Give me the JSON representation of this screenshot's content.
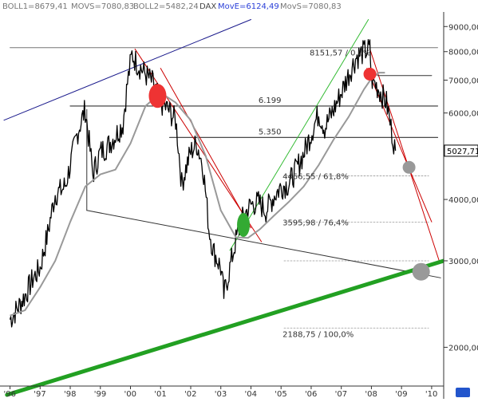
{
  "header": {
    "boll1": "BOLL1=8679,41",
    "movs": "MOVS=7080,83",
    "boll2": "BOLL2=5482,24",
    "symbol": "DAX",
    "move": "MovE=6124,49",
    "movs2": "MovS=7080,83"
  },
  "colors": {
    "price_bars": "#000000",
    "moving_avg": "#999999",
    "channel_red": "#cc0000",
    "trend_green_thick": "#22a022",
    "trend_green_thin": "#33bb33",
    "trend_blue": "#1a1a8c",
    "marker_red": "#ee3333",
    "marker_green": "#33aa33",
    "marker_gray": "#999999",
    "header_move": "#2a3fd8"
  },
  "chart_data": {
    "type": "line",
    "y_scale": "log",
    "ylim": [
      1680,
      9600
    ],
    "xlim": [
      1995.8,
      2010.4
    ],
    "x_ticks": [
      {
        "label": "'96",
        "x": 1996
      },
      {
        "label": "'97",
        "x": 1997
      },
      {
        "label": "'98",
        "x": 1998
      },
      {
        "label": "'99",
        "x": 1999
      },
      {
        "label": "'00",
        "x": 2000
      },
      {
        "label": "'01",
        "x": 2001
      },
      {
        "label": "'02",
        "x": 2002
      },
      {
        "label": "'03",
        "x": 2003
      },
      {
        "label": "'04",
        "x": 2004
      },
      {
        "label": "'05",
        "x": 2005
      },
      {
        "label": "'06",
        "x": 2006
      },
      {
        "label": "'07",
        "x": 2007
      },
      {
        "label": "'08",
        "x": 2008
      },
      {
        "label": "'09",
        "x": 2009
      },
      {
        "label": "'10",
        "x": 2010
      }
    ],
    "y_ticks": [
      {
        "label": "2000,00",
        "y": 2000
      },
      {
        "label": "3000,00",
        "y": 3000
      },
      {
        "label": "4000,00",
        "y": 4000
      },
      {
        "label": "5000,00",
        "y": 5000
      },
      {
        "label": "6000,00",
        "y": 6000
      },
      {
        "label": "7000,00",
        "y": 7000
      },
      {
        "label": "8000,00",
        "y": 8000
      },
      {
        "label": "9000,00",
        "y": 9000
      }
    ],
    "series": [
      {
        "kind": "price",
        "x": [
          1996.0,
          1996.25,
          1996.5,
          1996.75,
          1997.0,
          1997.25,
          1997.5,
          1997.75,
          1997.85,
          1998.0,
          1998.25,
          1998.5,
          1998.6,
          1998.75,
          1999.0,
          1999.25,
          1999.5,
          1999.75,
          1999.9,
          2000.05,
          2000.2,
          2000.5,
          2000.75,
          2001.0,
          2001.25,
          2001.5,
          2001.7,
          2002.0,
          2002.2,
          2002.4,
          2002.6,
          2002.75,
          2003.0,
          2003.1,
          2003.3,
          2003.5,
          2003.75,
          2004.0,
          2004.25,
          2004.5,
          2004.75,
          2005.0,
          2005.25,
          2005.5,
          2005.75,
          2006.0,
          2006.25,
          2006.45,
          2006.75,
          2007.0,
          2007.25,
          2007.5,
          2007.75,
          2007.95,
          2008.0,
          2008.25,
          2008.5,
          2008.65,
          2008.8
        ],
        "y": [
          2280,
          2400,
          2550,
          2750,
          2900,
          3400,
          4100,
          4200,
          4300,
          4700,
          5500,
          6100,
          5400,
          4500,
          5000,
          5150,
          5400,
          5700,
          6900,
          7900,
          7600,
          7200,
          6900,
          6300,
          6100,
          5800,
          4300,
          5000,
          5200,
          4700,
          3500,
          3150,
          2900,
          2550,
          2900,
          3300,
          3700,
          3900,
          3950,
          3800,
          4050,
          4250,
          4300,
          4600,
          4950,
          5450,
          6000,
          5600,
          6100,
          6600,
          7200,
          7800,
          8000,
          8100,
          7050,
          6700,
          6300,
          5600,
          5028
        ]
      },
      {
        "kind": "moving_average",
        "x": [
          1996.0,
          1996.5,
          1997.0,
          1997.5,
          1998.0,
          1998.5,
          1999.0,
          1999.5,
          2000.0,
          2000.5,
          2001.0,
          2001.5,
          2002.0,
          2002.5,
          2003.0,
          2003.5,
          2003.9,
          2004.3,
          2004.75,
          2005.25,
          2005.75,
          2006.25,
          2006.75,
          2007.25,
          2007.75,
          2008.0,
          2008.25,
          2008.45
        ],
        "y": [
          2320,
          2380,
          2650,
          3000,
          3600,
          4250,
          4500,
          4600,
          5200,
          6200,
          6600,
          6300,
          5800,
          4900,
          3800,
          3350,
          3340,
          3480,
          3700,
          3950,
          4250,
          4700,
          5300,
          5900,
          6700,
          7050,
          7250,
          7250
        ]
      }
    ],
    "levels": [
      {
        "label": "8151,57 / 0,0%",
        "value": 8151.57
      },
      {
        "label": "6.199",
        "value": 6199
      },
      {
        "label": "5.350",
        "value": 5350
      },
      {
        "label": "4466,55 / 61,8%",
        "value": 4466.55
      },
      {
        "label": "3595,98 / 76,4%",
        "value": 3595.98
      },
      {
        "label": "2188,75 / 100,0%",
        "value": 2188.75
      }
    ],
    "last_price_label": "5027,71",
    "last_price": 5027.71
  }
}
